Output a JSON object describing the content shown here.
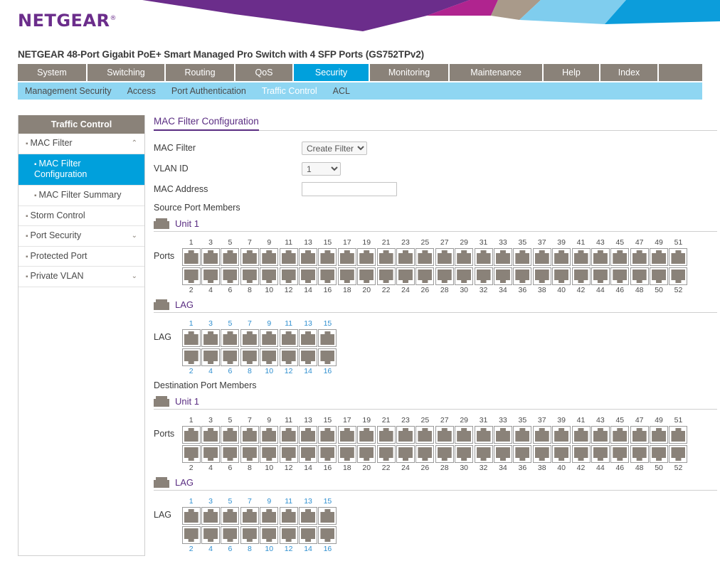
{
  "brand": {
    "logo_text": "NETGEAR",
    "logo_reg": "®",
    "colors": {
      "purple": "#6b2d8b",
      "magenta": "#b0248f",
      "tan": "#a99a8a",
      "light_blue": "#7fcdee",
      "blue": "#0c9ddb",
      "accent_active": "#00a0dc",
      "nav_brown": "#8a8279",
      "subnav_blue": "#8fd6f2",
      "title_purple": "#5a2d82",
      "port_gray": "#8a8279"
    }
  },
  "product_title": "NETGEAR 48-Port Gigabit PoE+ Smart Managed Pro Switch with 4 SFP Ports (GS752TPv2)",
  "nav_primary": [
    {
      "label": "System",
      "active": false
    },
    {
      "label": "Switching",
      "active": false
    },
    {
      "label": "Routing",
      "active": false
    },
    {
      "label": "QoS",
      "active": false
    },
    {
      "label": "Security",
      "active": true
    },
    {
      "label": "Monitoring",
      "active": false
    },
    {
      "label": "Maintenance",
      "active": false
    },
    {
      "label": "Help",
      "active": false
    },
    {
      "label": "Index",
      "active": false
    }
  ],
  "nav_secondary": [
    {
      "label": "Management Security",
      "active": false
    },
    {
      "label": "Access",
      "active": false
    },
    {
      "label": "Port Authentication",
      "active": false
    },
    {
      "label": "Traffic Control",
      "active": true
    },
    {
      "label": "ACL",
      "active": false
    }
  ],
  "sidebar": {
    "header": "Traffic Control",
    "items": [
      {
        "label": "MAC Filter",
        "level": 0,
        "active": false,
        "chevron": "up"
      },
      {
        "label": "MAC Filter Configuration",
        "level": 1,
        "active": true,
        "chevron": ""
      },
      {
        "label": "MAC Filter Summary",
        "level": 1,
        "active": false,
        "chevron": ""
      },
      {
        "label": "Storm Control",
        "level": 0,
        "active": false,
        "chevron": ""
      },
      {
        "label": "Port Security",
        "level": 0,
        "active": false,
        "chevron": "down"
      },
      {
        "label": "Protected Port",
        "level": 0,
        "active": false,
        "chevron": ""
      },
      {
        "label": "Private VLAN",
        "level": 0,
        "active": false,
        "chevron": "down"
      }
    ]
  },
  "panel": {
    "title": "MAC Filter Configuration",
    "fields": {
      "mac_filter_label": "MAC Filter",
      "mac_filter_value": "Create Filter",
      "mac_filter_options": [
        "Create Filter"
      ],
      "vlan_id_label": "VLAN ID",
      "vlan_id_value": "1",
      "vlan_id_options": [
        "1"
      ],
      "mac_address_label": "MAC Address",
      "mac_address_value": "",
      "mac_address_placeholder": ""
    },
    "source_label": "Source Port Members",
    "destination_label": "Destination Port Members"
  },
  "port_sections": [
    {
      "key": "source_unit1",
      "group_title": "Unit 1",
      "group_icon": "switch-stack-icon",
      "row_label": "Ports",
      "num_color": "dark",
      "top_numbers": [
        1,
        3,
        5,
        7,
        9,
        11,
        13,
        15,
        17,
        19,
        21,
        23,
        25,
        27,
        29,
        31,
        33,
        35,
        37,
        39,
        41,
        43,
        45,
        47,
        49,
        51
      ],
      "bottom_numbers": [
        2,
        4,
        6,
        8,
        10,
        12,
        14,
        16,
        18,
        20,
        22,
        24,
        26,
        28,
        30,
        32,
        34,
        36,
        38,
        40,
        42,
        44,
        46,
        48,
        50,
        52
      ]
    },
    {
      "key": "source_lag",
      "group_title": "LAG",
      "group_icon": "switch-stack-icon",
      "row_label": "LAG",
      "num_color": "blue",
      "top_numbers": [
        1,
        3,
        5,
        7,
        9,
        11,
        13,
        15
      ],
      "bottom_numbers": [
        2,
        4,
        6,
        8,
        10,
        12,
        14,
        16
      ]
    },
    {
      "key": "dest_unit1",
      "group_title": "Unit 1",
      "group_icon": "switch-stack-icon",
      "row_label": "Ports",
      "num_color": "dark",
      "top_numbers": [
        1,
        3,
        5,
        7,
        9,
        11,
        13,
        15,
        17,
        19,
        21,
        23,
        25,
        27,
        29,
        31,
        33,
        35,
        37,
        39,
        41,
        43,
        45,
        47,
        49,
        51
      ],
      "bottom_numbers": [
        2,
        4,
        6,
        8,
        10,
        12,
        14,
        16,
        18,
        20,
        22,
        24,
        26,
        28,
        30,
        32,
        34,
        36,
        38,
        40,
        42,
        44,
        46,
        48,
        50,
        52
      ]
    },
    {
      "key": "dest_lag",
      "group_title": "LAG",
      "group_icon": "switch-stack-icon",
      "row_label": "LAG",
      "num_color": "blue",
      "top_numbers": [
        1,
        3,
        5,
        7,
        9,
        11,
        13,
        15
      ],
      "bottom_numbers": [
        2,
        4,
        6,
        8,
        10,
        12,
        14,
        16
      ]
    }
  ]
}
